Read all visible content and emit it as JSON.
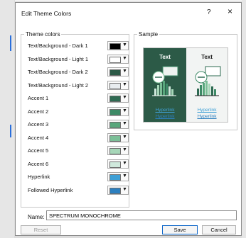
{
  "dialog": {
    "title": "Edit Theme Colors",
    "help": "?",
    "close": "×"
  },
  "theme_colors": {
    "legend": "Theme colors",
    "rows": [
      {
        "label": "Text/Background - Dark 1",
        "color": "#000000"
      },
      {
        "label": "Text/Background - Light 1",
        "color": "#ffffff"
      },
      {
        "label": "Text/Background - Dark 2",
        "color": "#2c5a47"
      },
      {
        "label": "Text/Background - Light 2",
        "color": "#e8ecef"
      },
      {
        "label": "Accent 1",
        "color": "#2e6a52"
      },
      {
        "label": "Accent 2",
        "color": "#3d8a66"
      },
      {
        "label": "Accent 3",
        "color": "#58a77c"
      },
      {
        "label": "Accent 4",
        "color": "#7bbf97"
      },
      {
        "label": "Accent 5",
        "color": "#a6d6b8"
      },
      {
        "label": "Accent 6",
        "color": "#cfe9dc"
      },
      {
        "label": "Hyperlink",
        "color": "#3fa0d6"
      },
      {
        "label": "Followed Hyperlink",
        "color": "#2c7fbf"
      }
    ]
  },
  "sample": {
    "legend": "Sample",
    "dark_text": "Text",
    "light_text": "Text",
    "hyperlink": "Hyperlink",
    "followed_hyperlink": "Hyperlink",
    "dark_bg": "#2c5a47",
    "light_bg": "#f2f4f3",
    "hyperlink_color": "#3fa0d6",
    "followed_color": "#2c7fbf"
  },
  "name": {
    "label": "Name:",
    "value": "SPECTRUM MONOCHROME"
  },
  "buttons": {
    "reset": "Reset",
    "save": "Save",
    "cancel": "Cancel"
  }
}
